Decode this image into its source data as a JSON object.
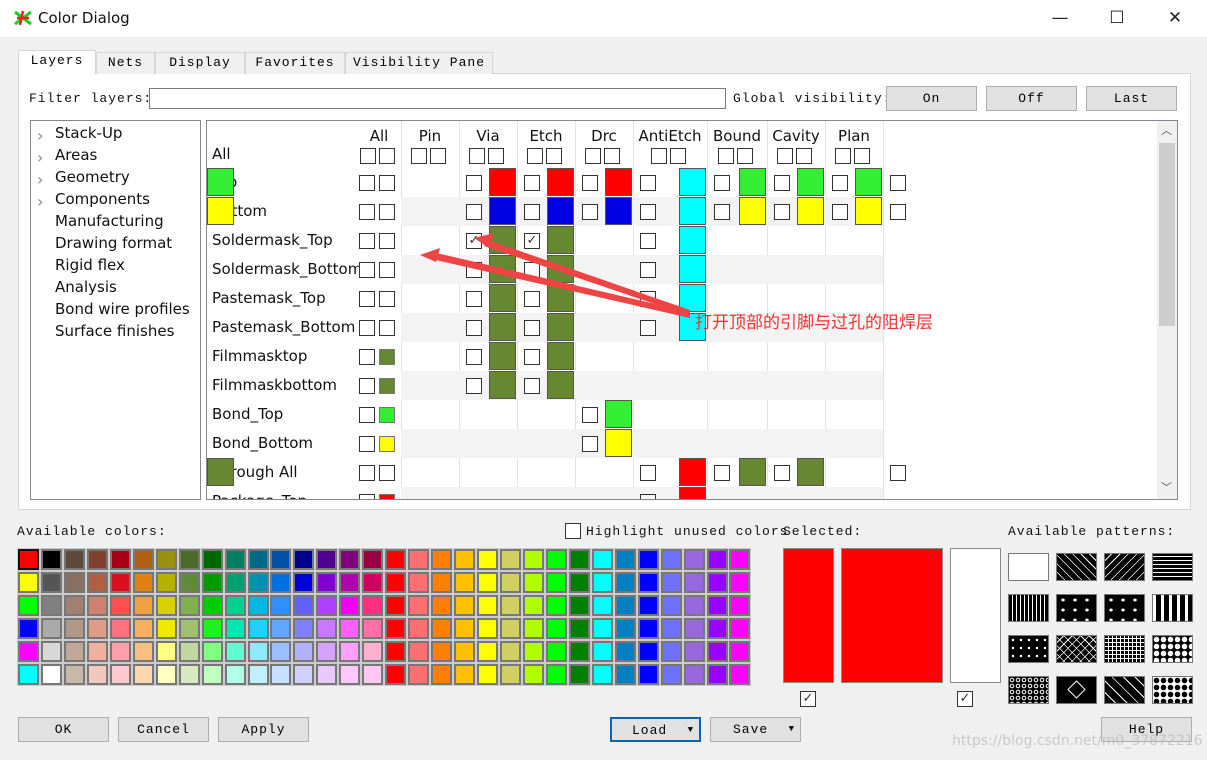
{
  "window": {
    "title": "Color Dialog",
    "minimize": "—",
    "maximize": "☐",
    "close": "✕"
  },
  "tabs": [
    {
      "label": "Layers",
      "active": true
    },
    {
      "label": "Nets"
    },
    {
      "label": "Display"
    },
    {
      "label": "Favorites"
    },
    {
      "label": "Visibility Pane"
    }
  ],
  "filter": {
    "label": "Filter layers:",
    "value": "",
    "global_label": "Global visibility:",
    "on": "On",
    "off": "Off",
    "last": "Last"
  },
  "tree": [
    {
      "label": "Stack-Up",
      "expandable": true
    },
    {
      "label": "Areas",
      "expandable": true
    },
    {
      "label": "Geometry",
      "expandable": true
    },
    {
      "label": "Components",
      "expandable": true
    },
    {
      "label": "Manufacturing"
    },
    {
      "label": "Drawing format"
    },
    {
      "label": "Rigid flex"
    },
    {
      "label": "Analysis"
    },
    {
      "label": "Bond wire profiles"
    },
    {
      "label": "Surface finishes"
    }
  ],
  "grid": {
    "columns": [
      "All",
      "Pin",
      "Via",
      "Etch",
      "Drc",
      "AntiEtch",
      "Bound",
      "Cavity",
      "Plan"
    ],
    "all_row_label": "All",
    "rows": [
      {
        "name": "Top",
        "all": null,
        "cells": [
          "#ff0000",
          "#ff0000",
          "#ff0000",
          "#00ffff",
          "#33ee33",
          "#33ee33",
          "#33ee33",
          "#33ee33"
        ]
      },
      {
        "name": "Bottom",
        "all": null,
        "cells": [
          "#0000e0",
          "#0000e0",
          "#0000e0",
          "#00ffff",
          "#ffff00",
          "#ffff00",
          "#ffff00",
          "#ffff00"
        ]
      },
      {
        "name": "Soldermask_Top",
        "all": null,
        "cells": [
          "#668833",
          "#668833",
          null,
          "#00ffff",
          null,
          null,
          null,
          null
        ],
        "checked": [
          0,
          1
        ]
      },
      {
        "name": "Soldermask_Bottom",
        "all": null,
        "cells": [
          "#668833",
          "#668833",
          null,
          "#00ffff",
          null,
          null,
          null,
          null
        ]
      },
      {
        "name": "Pastemask_Top",
        "all": null,
        "cells": [
          "#668833",
          "#668833",
          null,
          "#00ffff",
          null,
          null,
          null,
          null
        ]
      },
      {
        "name": "Pastemask_Bottom",
        "all": null,
        "cells": [
          "#668833",
          "#668833",
          null,
          "#00ffff",
          null,
          null,
          null,
          null
        ]
      },
      {
        "name": "Filmmasktop",
        "all": "#668833",
        "cells": [
          "#668833",
          "#668833",
          null,
          null,
          null,
          null,
          null,
          null
        ]
      },
      {
        "name": "Filmmaskbottom",
        "all": "#668833",
        "cells": [
          "#668833",
          "#668833",
          null,
          null,
          null,
          null,
          null,
          null
        ]
      },
      {
        "name": "Bond_Top",
        "all": "#33ee33",
        "cells": [
          null,
          null,
          "#33ee33",
          null,
          null,
          null,
          null,
          null
        ]
      },
      {
        "name": "Bond_Bottom",
        "all": "#ffff00",
        "cells": [
          null,
          null,
          "#ffff00",
          null,
          null,
          null,
          null,
          null
        ]
      },
      {
        "name": "Through All",
        "all": null,
        "cells": [
          null,
          null,
          null,
          "#ff0000",
          "#668833",
          "#668833",
          null,
          "#668833"
        ]
      },
      {
        "name": "Package_Top",
        "all": "#ff0000",
        "cells": [
          null,
          null,
          null,
          "#ff0000",
          null,
          null,
          null,
          null
        ]
      }
    ]
  },
  "annotation": {
    "text": "打开顶部的引脚与过孔的阻焊层",
    "color": "#ee3333"
  },
  "colors_label": "Available colors:",
  "highlight_label": "Highlight unused colors",
  "palette": {
    "rows": [
      [
        "#ff0000",
        "#000000",
        "#5c4a3c",
        "#7f4030",
        "#a80018",
        "#b06010",
        "#9a9010",
        "#4a6a2a",
        "#006600",
        "#008060",
        "#006888",
        "#0050a8",
        "#000090",
        "#500090",
        "#800080",
        "#980040"
      ],
      [
        "#ffff00",
        "#555555",
        "#887060",
        "#b06040",
        "#d81020",
        "#e08010",
        "#b8b000",
        "#608a3a",
        "#009a00",
        "#00a070",
        "#0090b0",
        "#0070e0",
        "#0000d8",
        "#8000d0",
        "#b000b0",
        "#d00060"
      ],
      [
        "#00ff00",
        "#808080",
        "#a08070",
        "#d08070",
        "#ff5050",
        "#f0a040",
        "#d8d000",
        "#80b050",
        "#00cc00",
        "#00d090",
        "#00b8e0",
        "#3090ff",
        "#6060ff",
        "#b040ff",
        "#f000f0",
        "#ff3080"
      ],
      [
        "#0000ff",
        "#aaaaaa",
        "#b09888",
        "#e09a88",
        "#ff7080",
        "#f8b060",
        "#f0e800",
        "#a0c070",
        "#20f020",
        "#00e8b0",
        "#20d0ff",
        "#60a8ff",
        "#8080ff",
        "#c878ff",
        "#ff60ff",
        "#ff70a8"
      ],
      [
        "#ff00ff",
        "#d8d8d8",
        "#c0a898",
        "#f0b0a0",
        "#ffa0a8",
        "#f8c080",
        "#ffff80",
        "#c0d8a0",
        "#80ff80",
        "#60ffd0",
        "#90e8ff",
        "#98c0ff",
        "#b0b0ff",
        "#d8a0ff",
        "#ffa0ff",
        "#ffb0d0"
      ],
      [
        "#00ffff",
        "#ffffff",
        "#c8b8a8",
        "#f0c8c0",
        "#ffc8d0",
        "#ffd8b0",
        "#ffffc0",
        "#d8e8c0",
        "#c0ffc0",
        "#b0ffe8",
        "#c0f0ff",
        "#c8e0ff",
        "#d0d0ff",
        "#e8c8ff",
        "#ffc8ff",
        "#ffc8f0"
      ]
    ],
    "shared": [
      "#ff0000",
      "#ff7070",
      "#ff8000",
      "#ffc000",
      "#ffff00",
      "#d0d060",
      "#b0ff00",
      "#00ff00",
      "#008000",
      "#00ffff",
      "#0080c0",
      "#0000ff",
      "#7070ff",
      "#9966dd",
      "#9900ff",
      "#ff00ff"
    ],
    "selected_index": [
      0,
      0
    ]
  },
  "selected": {
    "label": "Selected:",
    "color": "#ff0000",
    "fill": "#ff0000",
    "background": "#ffffff",
    "color_checked": true,
    "background_checked": true
  },
  "patterns": {
    "label": "Available patterns:",
    "names": [
      "solid",
      "diag-back",
      "diag-fwd",
      "horizontal",
      "vertical",
      "triangles",
      "plus",
      "dashes",
      "ticks",
      "crosshatch",
      "grid",
      "polka",
      "circles",
      "diamond",
      "large-diamond",
      "checker-diamond"
    ]
  },
  "buttons": {
    "ok": "OK",
    "cancel": "Cancel",
    "apply": "Apply",
    "load": "Load",
    "save": "Save",
    "help": "Help"
  },
  "watermark": "https://blog.csdn.net/m0_37872216"
}
